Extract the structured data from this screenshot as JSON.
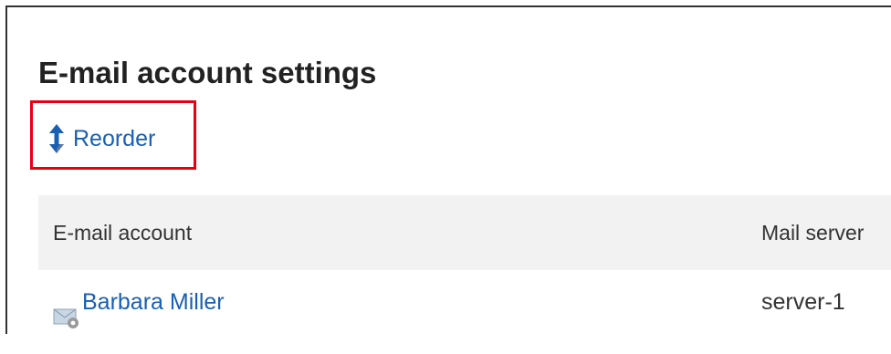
{
  "page": {
    "title": "E-mail account settings"
  },
  "toolbar": {
    "reorder_label": "Reorder",
    "reorder_icon": "vertical-arrows-icon",
    "highlight_color": "#e60012"
  },
  "table": {
    "columns": [
      {
        "label": "E-mail account"
      },
      {
        "label": "Mail server"
      }
    ],
    "rows": [
      {
        "account": "Barbara Miller",
        "account_icon": "mail-settings-icon",
        "server": "server-1"
      }
    ]
  },
  "colors": {
    "link": "#1a5fb4",
    "header_bg": "#f2f2f2",
    "text": "#333333"
  }
}
